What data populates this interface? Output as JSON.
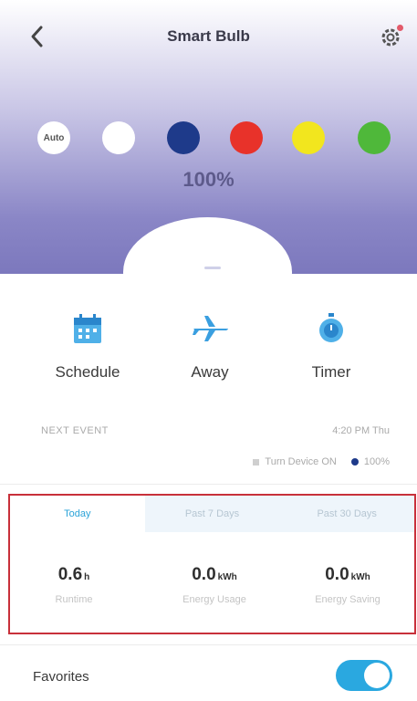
{
  "header": {
    "title": "Smart Bulb"
  },
  "colors": {
    "swatches": [
      {
        "label": "Auto",
        "color": "#ffffff"
      },
      {
        "color": "#ffffff"
      },
      {
        "color": "#1e3a8a"
      },
      {
        "color": "#e8322a"
      },
      {
        "color": "#f2e61e"
      },
      {
        "color": "#4fb83a"
      }
    ]
  },
  "brightness": "100%",
  "actions": [
    {
      "label": "Schedule",
      "icon": "calendar-icon"
    },
    {
      "label": "Away",
      "icon": "airplane-icon"
    },
    {
      "label": "Timer",
      "icon": "stopwatch-icon"
    }
  ],
  "next_event": {
    "label": "NEXT EVENT",
    "time": "4:20 PM Thu",
    "action": "Turn Device ON",
    "brightness": "100%"
  },
  "stats": {
    "tabs": [
      "Today",
      "Past 7 Days",
      "Past 30 Days"
    ],
    "active_tab": "Today",
    "items": [
      {
        "value": "0.6",
        "unit": "h",
        "caption": "Runtime"
      },
      {
        "value": "0.0",
        "unit": "kWh",
        "caption": "Energy Usage"
      },
      {
        "value": "0.0",
        "unit": "kWh",
        "caption": "Energy Saving"
      }
    ]
  },
  "favorites": {
    "label": "Favorites",
    "enabled": true
  },
  "theme": {
    "accent": "#2ba3d8",
    "toggle": "#2aa8e0",
    "highlight_border": "#c8303a"
  }
}
